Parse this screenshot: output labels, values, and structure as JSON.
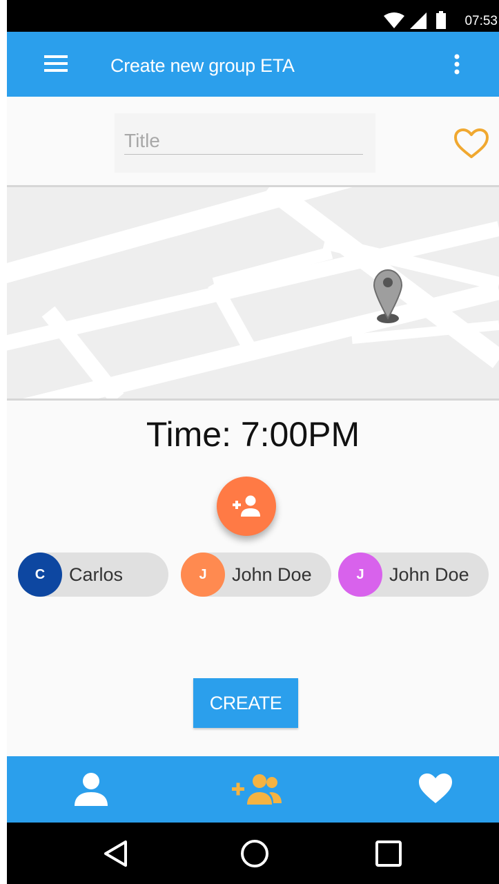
{
  "status_bar": {
    "time": "07:53"
  },
  "app_bar": {
    "title": "Create new group ETA"
  },
  "title_field": {
    "placeholder": "Title",
    "value": ""
  },
  "time_label": "Time: 7:00PM",
  "participants": [
    {
      "initial": "C",
      "name": "Carlos",
      "color": "#0d47a1"
    },
    {
      "initial": "J",
      "name": "John Doe",
      "color": "#ff8a50"
    },
    {
      "initial": "J",
      "name": "John Doe",
      "color": "#d862ec"
    }
  ],
  "create_button": {
    "label": "CREATE"
  },
  "colors": {
    "primary": "#2b9fec",
    "accent": "#ff7a45",
    "favorite": "#f0a830",
    "nav_active": "#f5b342"
  },
  "bottom_nav": {
    "items": [
      "person-icon",
      "group-add-icon",
      "heart-icon"
    ],
    "active": "group-add-icon"
  },
  "system_nav": [
    "back-icon",
    "home-icon",
    "recents-icon"
  ]
}
